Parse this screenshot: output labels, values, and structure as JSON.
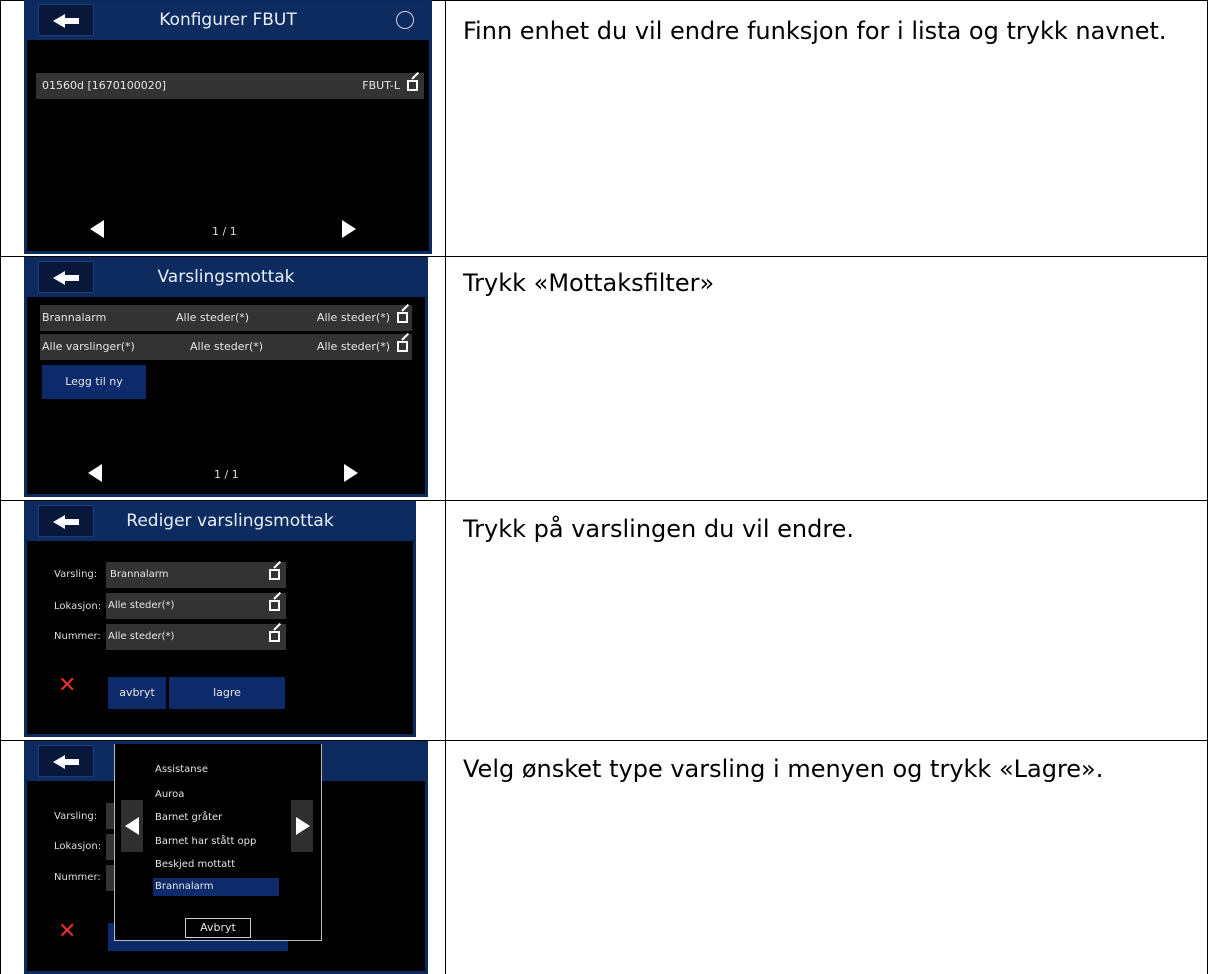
{
  "rows": [
    {
      "instruction": "Finn enhet du vil endre funksjon for i lista og trykk navnet.",
      "screen": {
        "title": "Konfigurer FBUT",
        "device_id": "01560d [1670100020]",
        "device_name": "FBUT-L",
        "pager": "1 / 1"
      }
    },
    {
      "instruction": "Trykk «Mottaksfilter»",
      "screen": {
        "title": "Varslingsmottak",
        "entries": [
          {
            "col1": "Brannalarm",
            "col2": "Alle steder(*)",
            "col3": "Alle steder(*)"
          },
          {
            "col1": "Alle varslinger(*)",
            "col2": "Alle steder(*)",
            "col3": "Alle steder(*)"
          }
        ],
        "add_button": "Legg til ny",
        "pager": "1 / 1"
      }
    },
    {
      "instruction": "Trykk på varslingen du vil endre.",
      "screen": {
        "title": "Rediger varslingsmottak",
        "fields": [
          {
            "label": "Varsling:",
            "value": "Brannalarm"
          },
          {
            "label": "Lokasjon:",
            "value": "Alle steder(*)"
          },
          {
            "label": "Nummer:",
            "value": "Alle steder(*)"
          }
        ],
        "cancel_button": "avbryt",
        "save_button": "lagre"
      }
    },
    {
      "instruction": "Velg ønsket type varsling i menyen og trykk «Lagre».",
      "screen": {
        "labels": [
          "Varsling:",
          "Lokasjon:",
          "Nummer:"
        ],
        "menu_items": [
          "Assistanse",
          "Auroa",
          "Barnet gråter",
          "Barnet har stått opp",
          "Beskjed mottatt",
          "Brannalarm"
        ],
        "selected_item": "Brannalarm",
        "menu_cancel": "Avbryt"
      }
    }
  ],
  "colors": {
    "titlebar": "#0d2b5f",
    "row_bg": "#333333",
    "selected_bg": "#0d2b6a",
    "close_red": "#e53030"
  }
}
